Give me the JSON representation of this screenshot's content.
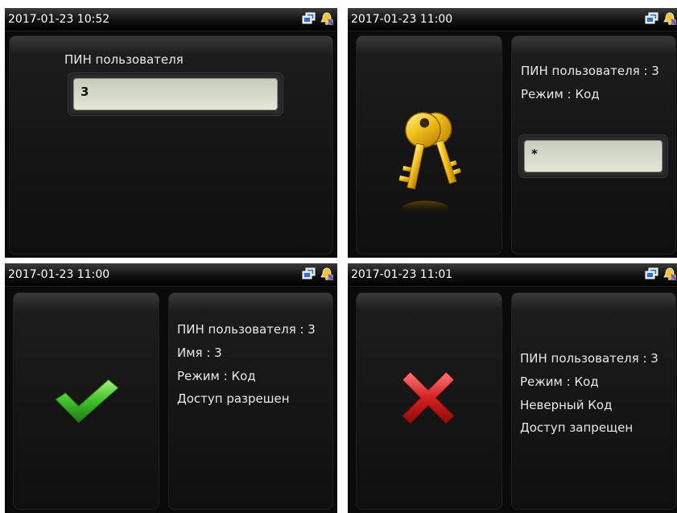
{
  "screens": [
    {
      "timestamp": "2017-01-23 10:52",
      "pin_label": "ПИН пользователя",
      "pin_value": "3"
    },
    {
      "timestamp": "2017-01-23 11:00",
      "icon": "keys-icon",
      "lines": [
        "ПИН пользователя : 3",
        "Режим : Код"
      ],
      "input_value": "*"
    },
    {
      "timestamp": "2017-01-23 11:00",
      "icon": "checkmark-icon",
      "lines": [
        "ПИН пользователя : 3",
        "Имя : 3",
        "Режим : Код",
        "Доступ разрешен"
      ]
    },
    {
      "timestamp": "2017-01-23 11:01",
      "icon": "cross-icon",
      "lines": [
        "ПИН пользователя : 3",
        "Режим : Код",
        "Неверный Код",
        "Доступ запрещен"
      ]
    }
  ],
  "status_icons": [
    "network-icon",
    "bell-icon"
  ],
  "colors": {
    "screen_bg": "#0a0a0a",
    "text": "#e9e9e9",
    "input_bg": "#d8dccb",
    "success": "#3fbf2a",
    "error": "#c81e1e",
    "keys": "#e8b010"
  }
}
